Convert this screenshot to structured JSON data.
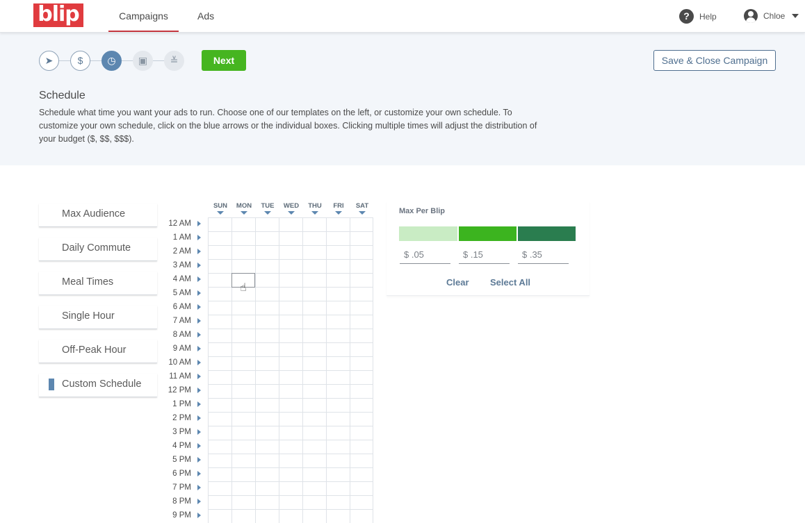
{
  "header": {
    "logo": "blip",
    "tabs": [
      {
        "label": "Campaigns"
      },
      {
        "label": "Ads"
      }
    ],
    "help_label": "Help",
    "user_name": "Chloe"
  },
  "steps": {
    "icons": [
      "location-arrow-icon",
      "dollar-icon",
      "clock-icon",
      "image-icon",
      "sliders-icon"
    ],
    "glyphs": [
      "➤",
      "$",
      "◷",
      "▣",
      "≚"
    ],
    "current_index": 2,
    "next_label": "Next",
    "save_label": "Save & Close Campaign"
  },
  "schedule": {
    "title": "Schedule",
    "description": "Schedule what time you want your ads to run. Choose one of our templates on the left, or customize your own schedule. To customize your own schedule, click on the blue arrows or the individual boxes. Clicking multiple times will adjust the distribution of your budget ($, $$, $$$)."
  },
  "templates": [
    {
      "label": "Max Audience",
      "selected": false
    },
    {
      "label": "Daily Commute",
      "selected": false
    },
    {
      "label": "Meal Times",
      "selected": false
    },
    {
      "label": "Single Hour",
      "selected": false
    },
    {
      "label": "Off-Peak Hour",
      "selected": false
    },
    {
      "label": "Custom Schedule",
      "selected": true
    }
  ],
  "grid": {
    "days": [
      "SUN",
      "MON",
      "TUE",
      "WED",
      "THU",
      "FRI",
      "SAT"
    ],
    "hours": [
      "12 AM",
      "1 AM",
      "2 AM",
      "3 AM",
      "4 AM",
      "5 AM",
      "6 AM",
      "7 AM",
      "8 AM",
      "9 AM",
      "10 AM",
      "11 AM",
      "12 PM",
      "1 PM",
      "2 PM",
      "3 PM",
      "4 PM",
      "5 PM",
      "6 PM",
      "7 PM",
      "8 PM",
      "9 PM"
    ]
  },
  "bid": {
    "title": "Max Per Blip",
    "tiers": [
      {
        "value": "$ .05",
        "color": "#c9ecc4"
      },
      {
        "value": "$ .15",
        "color": "#3cb41f"
      },
      {
        "value": "$ .35",
        "color": "#2a7d4f"
      }
    ],
    "clear_label": "Clear",
    "select_all_label": "Select All"
  },
  "colors": {
    "accent": "#5d87b0",
    "brand": "#e03b3f",
    "next_green": "#46b520"
  }
}
